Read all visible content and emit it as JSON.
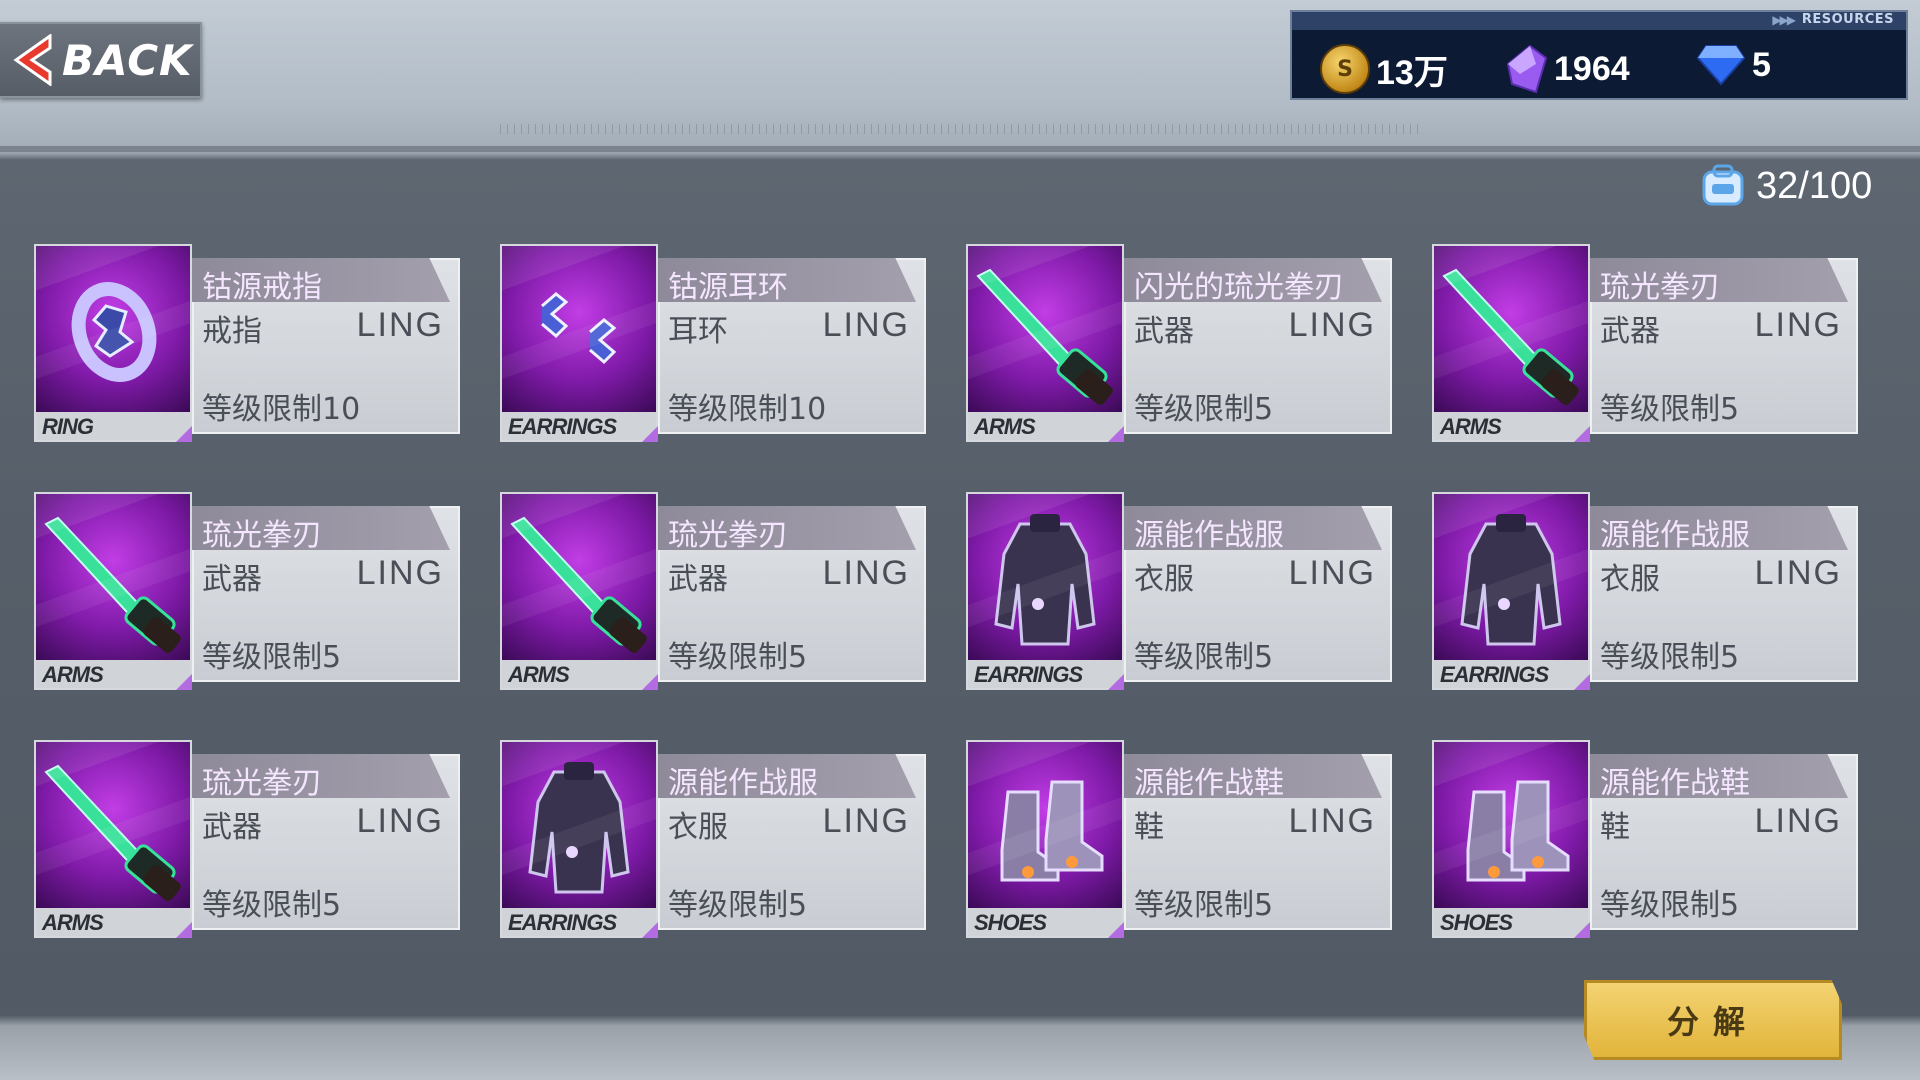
{
  "header": {
    "back_label": "BACK"
  },
  "resources": {
    "tag": "RESOURCES",
    "gold": "13万",
    "crystal": "1964",
    "diamond": "5"
  },
  "inventory": {
    "capacity": "32/100"
  },
  "items": [
    {
      "name": "钴源戒指",
      "type": "戒指",
      "grade": "LING",
      "level": "等级限制10",
      "tag": "RING",
      "icon": "ring-icon"
    },
    {
      "name": "钴源耳环",
      "type": "耳环",
      "grade": "LING",
      "level": "等级限制10",
      "tag": "EARRINGS",
      "icon": "earrings-icon"
    },
    {
      "name": "闪光的琉光拳刃",
      "type": "武器",
      "grade": "LING",
      "level": "等级限制5",
      "tag": "ARMS",
      "icon": "blade-icon"
    },
    {
      "name": "琉光拳刃",
      "type": "武器",
      "grade": "LING",
      "level": "等级限制5",
      "tag": "ARMS",
      "icon": "blade-icon"
    },
    {
      "name": "琉光拳刃",
      "type": "武器",
      "grade": "LING",
      "level": "等级限制5",
      "tag": "ARMS",
      "icon": "blade-icon"
    },
    {
      "name": "琉光拳刃",
      "type": "武器",
      "grade": "LING",
      "level": "等级限制5",
      "tag": "ARMS",
      "icon": "blade-icon"
    },
    {
      "name": "源能作战服",
      "type": "衣服",
      "grade": "LING",
      "level": "等级限制5",
      "tag": "EARRINGS",
      "icon": "battle-suit-icon"
    },
    {
      "name": "源能作战服",
      "type": "衣服",
      "grade": "LING",
      "level": "等级限制5",
      "tag": "EARRINGS",
      "icon": "battle-suit-icon"
    },
    {
      "name": "琉光拳刃",
      "type": "武器",
      "grade": "LING",
      "level": "等级限制5",
      "tag": "ARMS",
      "icon": "blade-icon"
    },
    {
      "name": "源能作战服",
      "type": "衣服",
      "grade": "LING",
      "level": "等级限制5",
      "tag": "EARRINGS",
      "icon": "battle-suit-icon"
    },
    {
      "name": "源能作战鞋",
      "type": "鞋",
      "grade": "LING",
      "level": "等级限制5",
      "tag": "SHOES",
      "icon": "shoes-icon"
    },
    {
      "name": "源能作战鞋",
      "type": "鞋",
      "grade": "LING",
      "level": "等级限制5",
      "tag": "SHOES",
      "icon": "shoes-icon"
    }
  ],
  "actions": {
    "decompose_label": "分解"
  },
  "colors": {
    "gold_button": "#e8be48",
    "rarity_purple": "#9a2fd0",
    "panel_bg": "#565e69"
  }
}
